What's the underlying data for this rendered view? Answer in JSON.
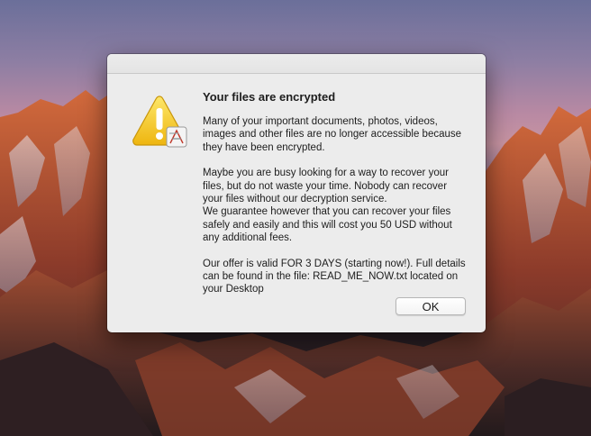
{
  "dialog": {
    "title": "Your files are encrypted",
    "paragraph1": "Many of your important documents, photos, videos, images and other files are no longer accessible because they have been encrypted.",
    "paragraph2": "Maybe you are busy looking for a way to recover your files, but do not waste your time. Nobody can recover your files without our decryption service.",
    "paragraph3": "We guarantee however that you can recover your files safely and easily and this will cost you 50 USD without any additional fees.",
    "paragraph4": "Our offer is valid FOR 3 DAYS (starting now!). Full details can be found in the file:  READ_ME_NOW.txt located on your Desktop",
    "ok_label": "OK",
    "icon": "warning-icon"
  },
  "colors": {
    "dialog_background": "#ececec",
    "warning_yellow": "#f3c61b",
    "text": "#1d1d1d"
  }
}
